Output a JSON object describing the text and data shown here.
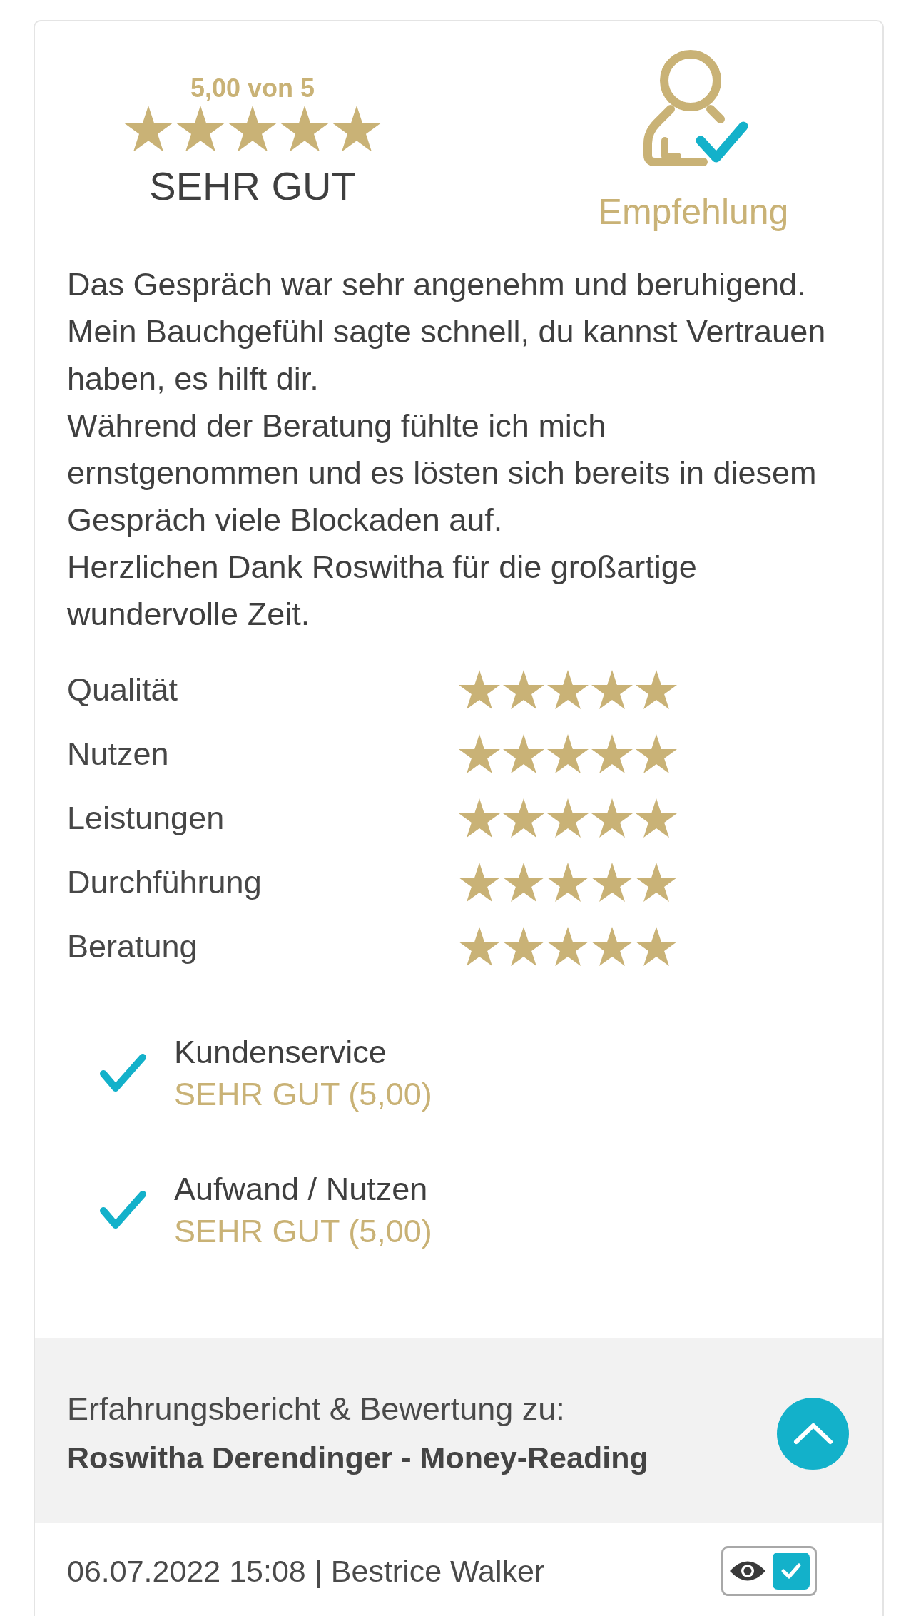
{
  "summary": {
    "score": "5,00 von 5",
    "stars": 5,
    "verdict": "SEHR GUT"
  },
  "recommendation": {
    "label": "Empfehlung"
  },
  "review_text": "Das Gespräch war sehr angenehm und beruhigend.\nMein Bauchgefühl sagte schnell, du kannst Vertrauen haben, es hilft dir.\nWährend der Beratung fühlte ich mich ernstgenommen und es lösten sich bereits in diesem Gespräch viele Blockaden auf.\nHerzlichen Dank Roswitha für die großartige wundervolle Zeit.",
  "criteria": [
    {
      "label": "Qualität",
      "stars": 5
    },
    {
      "label": "Nutzen",
      "stars": 5
    },
    {
      "label": "Leistungen",
      "stars": 5
    },
    {
      "label": "Durchführung",
      "stars": 5
    },
    {
      "label": "Beratung",
      "stars": 5
    }
  ],
  "highlights": [
    {
      "title": "Kundenservice",
      "verdict": "SEHR GUT (5,00)"
    },
    {
      "title": "Aufwand / Nutzen",
      "verdict": "SEHR GUT (5,00)"
    }
  ],
  "footer": {
    "intro": "Erfahrungsbericht & Bewertung zu:",
    "subject": "Roswitha Derendinger - Money-Reading"
  },
  "meta": {
    "byline": "06.07.2022 15:08 | Bestrice Walker",
    "visible_checked": true
  }
}
